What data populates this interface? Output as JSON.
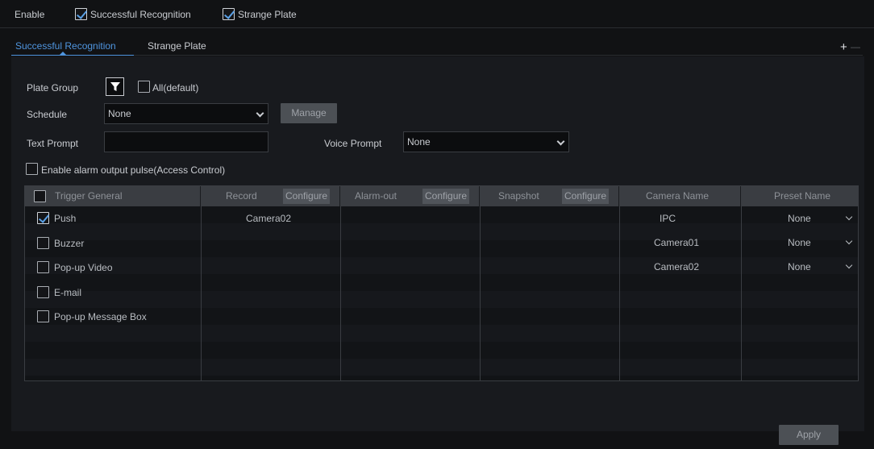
{
  "enable": {
    "label": "Enable",
    "successful_recognition": "Successful Recognition",
    "strange_plate": "Strange Plate"
  },
  "tabs": [
    {
      "label": "Successful Recognition",
      "active": true
    },
    {
      "label": "Strange Plate",
      "active": false
    }
  ],
  "corner": {
    "plus": "+",
    "minus": "—"
  },
  "form": {
    "plate_group_label": "Plate Group",
    "all_default_label": "All(default)",
    "schedule_label": "Schedule",
    "schedule_value": "None",
    "manage_label": "Manage",
    "text_prompt_label": "Text Prompt",
    "text_prompt_value": "",
    "voice_prompt_label": "Voice Prompt",
    "voice_prompt_value": "None",
    "alarm_pulse_label": "Enable alarm output pulse(Access Control)"
  },
  "table": {
    "headers": {
      "trigger_general": "Trigger General",
      "record": "Record",
      "alarm_out": "Alarm-out",
      "snapshot": "Snapshot",
      "configure": "Configure",
      "camera_name": "Camera Name",
      "preset_name": "Preset Name"
    },
    "triggers": [
      {
        "label": "Push",
        "checked": true
      },
      {
        "label": "Buzzer",
        "checked": false
      },
      {
        "label": "Pop-up Video",
        "checked": false
      },
      {
        "label": "E-mail",
        "checked": false
      },
      {
        "label": "Pop-up Message Box",
        "checked": false
      }
    ],
    "record_cameras": [
      "Camera02"
    ],
    "presets": [
      {
        "camera": "IPC",
        "preset": "None"
      },
      {
        "camera": "Camera01",
        "preset": "None"
      },
      {
        "camera": "Camera02",
        "preset": "None"
      }
    ]
  },
  "footer": {
    "apply_label": "Apply"
  },
  "colors": {
    "accent": "#4f95df",
    "background": "#111214",
    "header": "#3a3d42"
  }
}
